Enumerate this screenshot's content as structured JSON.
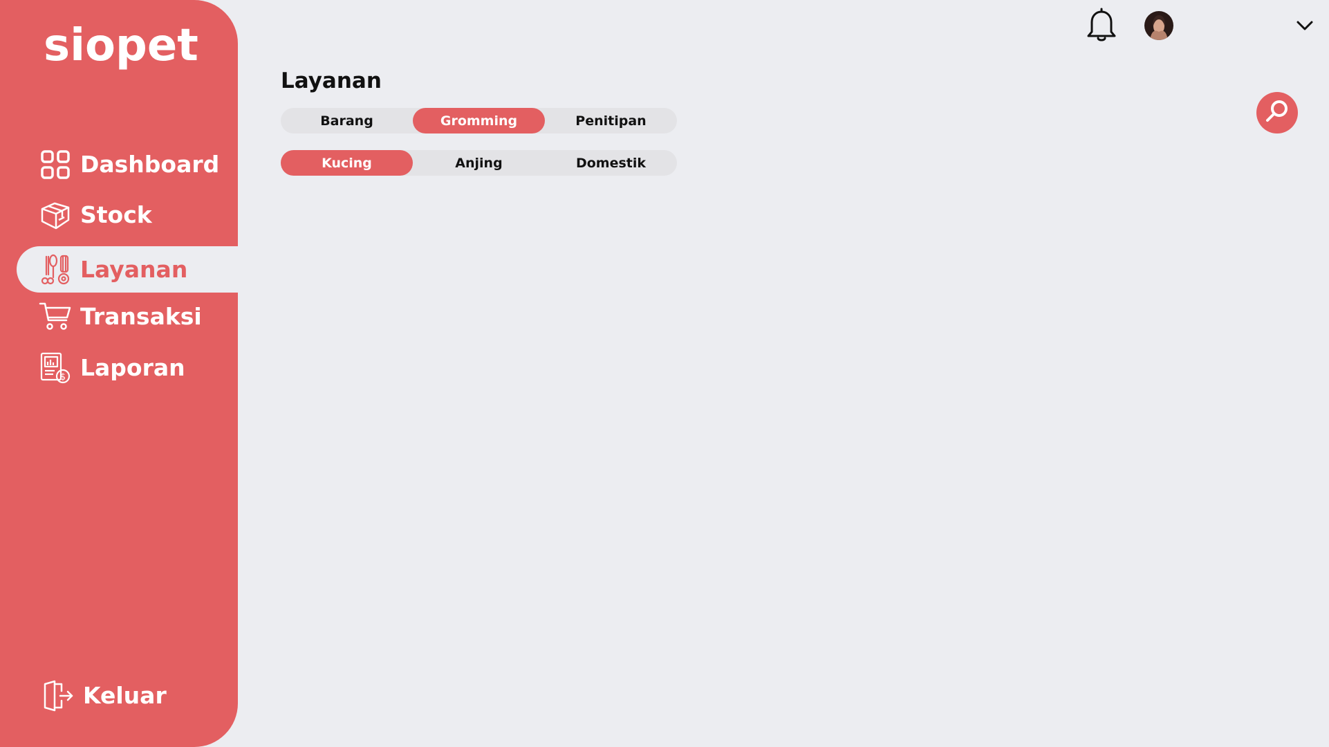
{
  "app": {
    "logo": "siopet"
  },
  "colors": {
    "brand": "#E35F61",
    "background": "#ECEDF1",
    "segment_bg": "#E3E3E6",
    "text_dark": "#111111"
  },
  "sidebar": {
    "items": [
      {
        "label": "Dashboard",
        "icon": "grid-icon",
        "active": false
      },
      {
        "label": "Stock",
        "icon": "box-icon",
        "active": false
      },
      {
        "label": "Layanan",
        "icon": "grooming-tools-icon",
        "active": true
      },
      {
        "label": "Transaksi",
        "icon": "shopping-cart-icon",
        "active": false
      },
      {
        "label": "Laporan",
        "icon": "report-icon",
        "active": false
      }
    ],
    "logout_label": "Keluar",
    "logout_icon": "logout-icon"
  },
  "topbar": {
    "notification_icon": "bell-icon",
    "avatar_icon": "user-avatar",
    "dropdown_icon": "chevron-down-icon"
  },
  "main": {
    "title": "Layanan",
    "category_tabs": [
      {
        "label": "Barang",
        "active": false
      },
      {
        "label": "Gromming",
        "active": true
      },
      {
        "label": "Penitipan",
        "active": false
      }
    ],
    "animal_tabs": [
      {
        "label": "Kucing",
        "active": true
      },
      {
        "label": "Anjing",
        "active": false
      },
      {
        "label": "Domestik",
        "active": false
      }
    ],
    "search_icon": "search-icon"
  }
}
